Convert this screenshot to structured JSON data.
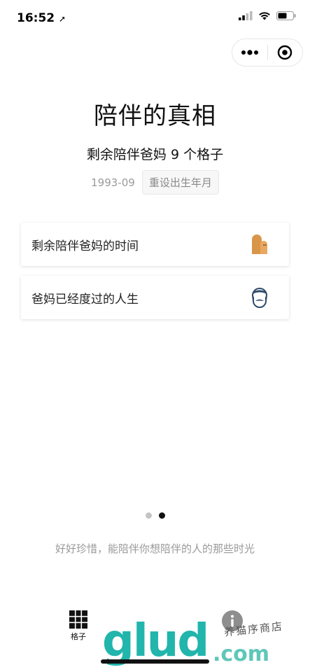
{
  "status_bar": {
    "time": "16:52"
  },
  "header": {
    "title": "陪伴的真相"
  },
  "summary": {
    "text": "剩余陪伴爸妈 9 个格子"
  },
  "birth": {
    "date": "1993-09",
    "reset_label": "重设出生年月"
  },
  "cards": [
    {
      "label": "剩余陪伴爸妈的时间",
      "icon": "doll-icon"
    },
    {
      "label": "爸妈已经度过的人生",
      "icon": "man-face-icon"
    }
  ],
  "pagination": {
    "count": 2,
    "active": 1
  },
  "footer": {
    "quote": "好好珍惜，能陪伴你想陪伴的人的那些时光"
  },
  "tab_bar": {
    "grid_label": "格子"
  },
  "watermark": {
    "logo": "glud",
    "suffix": ".com",
    "tagline": "养猫序商店"
  },
  "colors": {
    "doll_icon": "#d9964a",
    "face_icon": "#2f4a6b",
    "watermark": "#21b5ac"
  }
}
